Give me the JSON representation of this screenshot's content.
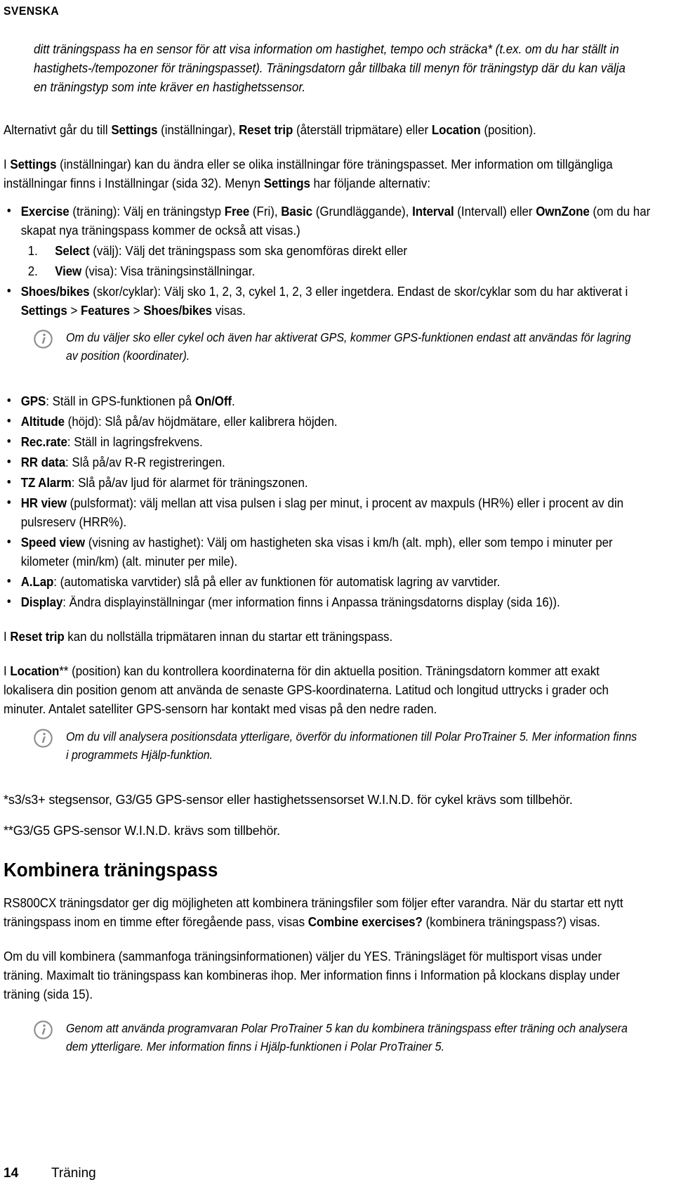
{
  "document": {
    "running_head": "SVENSKA",
    "language": "Swedish"
  },
  "intro_paragraph": {
    "line1": "ditt träningspass ha en sensor för att visa information om hastighet, tempo och sträcka* (t.ex. om du har ställt in",
    "line2": "hastighets-/tempozoner för träningspasset). Träningsdatorn går tillbaka till menyn för träningstyp där du kan",
    "line3": "välja en träningstyp som inte kräver en hastighetssensor."
  },
  "paragraphs": {
    "alternativt": {
      "before_settings": "Alternativt går du till ",
      "menu_settings": "Settings",
      "after_settings": " (inställningar), ",
      "menu_reset_trip": "Reset trip",
      "after_reset": " (återställ tripmätare) eller ",
      "menu_location": "Location",
      "after_location": " (position)."
    },
    "i_settings": {
      "seg1": "I ",
      "menu1": "Settings",
      "seg2": " (inställningar) kan du ändra eller se olika inställningar före träningspasset. Mer information om tillgängliga inställningar finns i Inställningar (sida 32). Menyn ",
      "menu2": "Settings",
      "seg3": " har följande alternativ:"
    },
    "reset_trip_para": {
      "seg1": "I ",
      "menu1": "Reset trip",
      "seg2": " kan du nollställa tripmätaren innan du startar ett träningspass."
    },
    "location_para": {
      "seg1": "I ",
      "menu1": "Location",
      "seg2": "** (position) kan du kontrollera koordinaterna för din aktuella position. Träningsdatorn kommer att exakt lokalisera din position genom att använda de senaste GPS-koordinaterna. Latitud och longitud uttrycks i grader och minuter. Antalet satelliter GPS-sensorn har kontakt med visas på den nedre raden."
    }
  },
  "settings_menu_list": {
    "exercise": {
      "menu": "Exercise",
      "seg1": " (träning): Välj en träningstyp ",
      "menu_free": "Free",
      "seg2": " (Fri), ",
      "menu_basic": "Basic",
      "seg3": " (Grundläggande), ",
      "menu_interval": "Interval",
      "seg4": " (Intervall) eller ",
      "menu_ownzone": "OwnZone",
      "seg5": " (om du har skapat nya träningspass kommer de också att visas.)"
    },
    "numbered": [
      {
        "index": "1.",
        "menu": "Select",
        "text": " (välj): Välj det träningspass som ska genomföras direkt eller"
      },
      {
        "index": "2.",
        "menu": "View",
        "text": " (visa): Visa träningsinställningar."
      }
    ],
    "shoes_bikes": {
      "menu": "Shoes/bikes",
      "seg1": " (skor/cyklar): Välj sko 1, 2, 3, cykel 1, 2, 3 eller ingetdera. Endast de skor/cyklar som du har aktiverat i ",
      "menu_settings": "Settings",
      "sep1": " > ",
      "menu_features": "Features",
      "sep2": " > ",
      "menu_shoes": "Shoes/bikes",
      "seg2": " visas."
    }
  },
  "feature_list": [
    {
      "menu": "GPS",
      "seg1": ": Ställ in GPS-funktionen på ",
      "menu2": "On/Off",
      "seg2": "."
    },
    {
      "menu": "Altitude",
      "seg1": " (höjd): Slå på/av höjdmätare, eller kalibrera höjden."
    },
    {
      "menu": "Rec.rate",
      "seg1": ": Ställ in lagringsfrekvens."
    },
    {
      "menu": "RR data",
      "seg1": ": Slå på/av R-R registreringen."
    },
    {
      "menu": "TZ Alarm",
      "seg1": ": Slå på/av ljud för alarmet för träningszonen."
    },
    {
      "menu": "HR view",
      "seg1": " (pulsformat): välj mellan att visa pulsen i slag per minut, i procent av maxpuls (HR%) eller i procent av din pulsreserv (HRR%)."
    },
    {
      "menu": "Speed view",
      "seg1": " (visning av hastighet): Välj om hastigheten ska visas i km/h (alt. mph), eller som tempo i minuter per kilometer (min/km) (alt. minuter per mile)."
    },
    {
      "menu": "A.Lap",
      "seg1": ": (automatiska varvtider) slå på eller av funktionen för automatisk lagring av varvtider."
    },
    {
      "menu": "Display",
      "seg1": ": Ändra displayinställningar (mer information finns i Anpassa träningsdatorns display (sida 16))."
    }
  ],
  "notes": [
    {
      "icon": "info-icon",
      "text": "Om du väljer sko eller cykel och även har aktiverat GPS, kommer GPS-funktionen endast att användas för lagring av position (koordinater)."
    },
    {
      "icon": "info-icon",
      "text": "Om du vill analysera positionsdata ytterligare, överför du informationen till Polar ProTrainer 5. Mer information finns i programmets Hjälp-funktion."
    },
    {
      "icon": "info-icon",
      "text": "Genom att använda programvaran Polar ProTrainer 5 kan du kombinera träningspass efter träning och analysera dem ytterligare. Mer information finns i Hjälp-funktionen i Polar ProTrainer 5."
    }
  ],
  "footnotes": [
    "*s3/s3+ stegsensor, G3/G5 GPS-sensor eller hastighetssensorset W.I.N.D. för cykel krävs som tillbehör.",
    "**G3/G5 GPS-sensor W.I.N.D. krävs som tillbehör."
  ],
  "section": {
    "heading": "Kombinera träningspass",
    "para1": {
      "seg1": "RS800CX träningsdator ger dig möjligheten att kombinera träningsfiler som följer efter varandra. När du startar ett nytt träningspass inom en timme efter föregående pass, visas ",
      "menu": "Combine exercises?",
      "seg2": " (kombinera träningspass?) visas."
    },
    "para2": "Om du vill kombinera (sammanfoga träningsinformationen) väljer du YES. Träningsläget för multisport visas under träning. Maximalt tio träningspass kan kombineras ihop. Mer information finns i Information på klockans display under träning (sida 15)."
  },
  "footer": {
    "page_number": "14",
    "section_name": "Träning"
  },
  "colors": {
    "text": "#000000",
    "background": "#ffffff",
    "note_icon": "#8c8c8c"
  }
}
